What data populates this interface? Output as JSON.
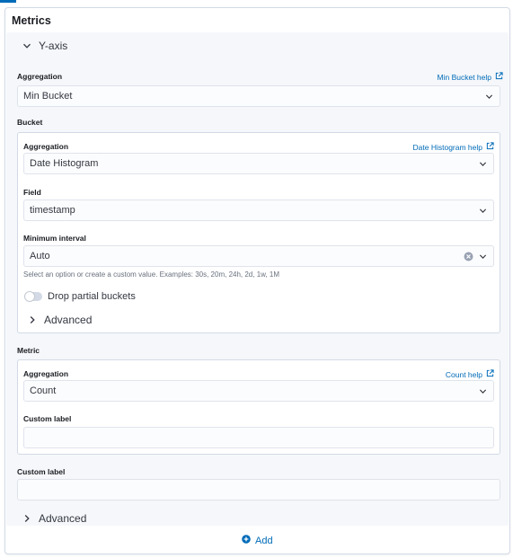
{
  "panel": {
    "title": "Metrics"
  },
  "yaxis": {
    "toggle_label": "Y-axis",
    "aggregation_label": "Aggregation",
    "aggregation_help": "Min Bucket help",
    "aggregation_value": "Min Bucket"
  },
  "bucket": {
    "title": "Bucket",
    "aggregation_label": "Aggregation",
    "aggregation_help": "Date Histogram help",
    "aggregation_value": "Date Histogram",
    "field_label": "Field",
    "field_value": "timestamp",
    "interval_label": "Minimum interval",
    "interval_value": "Auto",
    "interval_hint": "Select an option or create a custom value. Examples: 30s, 20m, 24h, 2d, 1w, 1M",
    "drop_partial_label": "Drop partial buckets",
    "drop_partial_enabled": false,
    "advanced_label": "Advanced"
  },
  "metric": {
    "title": "Metric",
    "aggregation_label": "Aggregation",
    "aggregation_help": "Count help",
    "aggregation_value": "Count",
    "custom_label_label": "Custom label",
    "custom_label_value": ""
  },
  "custom_label": {
    "label": "Custom label",
    "value": ""
  },
  "advanced": {
    "label": "Advanced"
  },
  "add_button": {
    "label": "Add"
  },
  "colors": {
    "accent": "#006bb8",
    "panel_bg": "#f5f7fa",
    "border": "#d3dae6"
  }
}
